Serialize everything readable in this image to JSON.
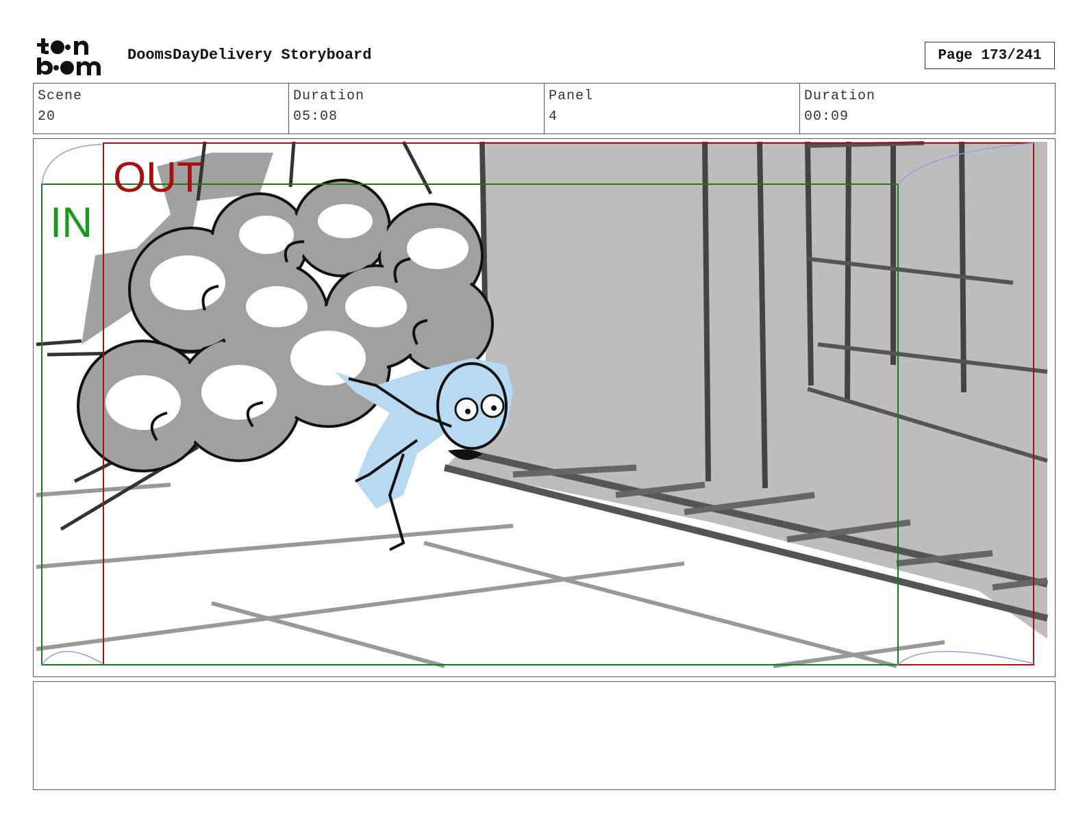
{
  "header": {
    "logo_line1": "toon",
    "logo_line2": "boom",
    "title": "DoomsDayDelivery Storyboard",
    "page": "Page 173/241"
  },
  "info": {
    "scene_label": "Scene",
    "scene_value": "20",
    "scene_duration_label": "Duration",
    "scene_duration_value": "05:08",
    "panel_label": "Panel",
    "panel_value": "4",
    "panel_duration_label": "Duration",
    "panel_duration_value": "00:09"
  },
  "panel": {
    "in_label": "IN",
    "out_label": "OUT",
    "in_color": "#1a9a1a",
    "out_color": "#a81010",
    "character_color": "#b8d9f2",
    "wall_color": "#bdbdbd"
  },
  "notes": {
    "text": ""
  }
}
